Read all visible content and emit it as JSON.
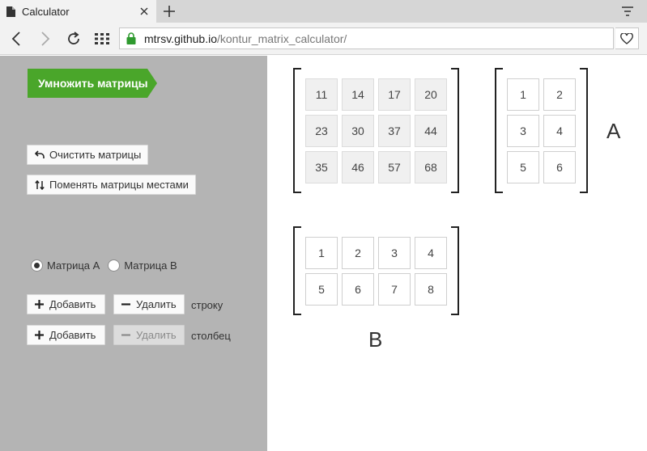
{
  "browser": {
    "tab_title": "Calculator",
    "address_domain": "mtrsv.github.io",
    "address_path": "/kontur_matrix_calculator/"
  },
  "sidebar": {
    "multiply_label": "Умножить матрицы",
    "clear_label": "Очистить матрицы",
    "swap_label": "Поменять матрицы местами",
    "radio_a_label": "Матрица A",
    "radio_b_label": "Матрица B",
    "selected_matrix": "A",
    "add_label": "Добавить",
    "remove_label": "Удалить",
    "row_label": "строку",
    "col_label": "столбец",
    "colors": {
      "panel": "#b4b4b4",
      "accent": "#4aa62a"
    }
  },
  "matrices": {
    "result": {
      "rows": [
        [
          "11",
          "14",
          "17",
          "20"
        ],
        [
          "23",
          "30",
          "37",
          "44"
        ],
        [
          "35",
          "46",
          "57",
          "68"
        ]
      ]
    },
    "a": {
      "name": "A",
      "rows": [
        [
          "1",
          "2"
        ],
        [
          "3",
          "4"
        ],
        [
          "5",
          "6"
        ]
      ]
    },
    "b": {
      "name": "B",
      "rows": [
        [
          "1",
          "2",
          "3",
          "4"
        ],
        [
          "5",
          "6",
          "7",
          "8"
        ]
      ]
    }
  }
}
